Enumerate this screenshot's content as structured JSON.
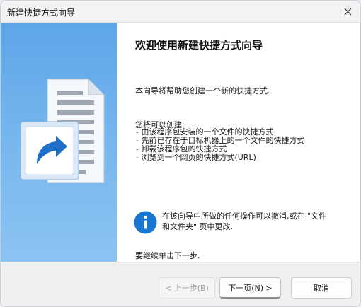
{
  "window": {
    "title": "新建快捷方式向导"
  },
  "content": {
    "heading": "欢迎使用新建快捷方式向导",
    "intro": "本向导将帮助您创建一个新的快捷方式.",
    "can_label": "您将可以创建:",
    "capabilities": [
      "- 由该程序包安装的一个文件的快捷方式",
      "- 先前已存在于目标机器上的一个文件的快捷方式",
      "- 卸载该程序包的快捷方式",
      "- 浏览到一个网页的快捷方式(URL)"
    ],
    "info_line1": "在该向导中所做的任何操作可以撤消,或在 \"文件",
    "info_line2": "和文件夹\" 页中更改.",
    "continue": "要继续单击下一步."
  },
  "buttons": {
    "back": "< 上一步(B)",
    "next": "下一页(N) >",
    "cancel": "取消"
  },
  "icons": {
    "close": "close-icon",
    "info": "info-icon",
    "shortcut": "shortcut-document-icon"
  },
  "colors": {
    "panel": "#6aaeea",
    "info_blue": "#1777d2",
    "arrow_blue": "#1e6fc7"
  }
}
